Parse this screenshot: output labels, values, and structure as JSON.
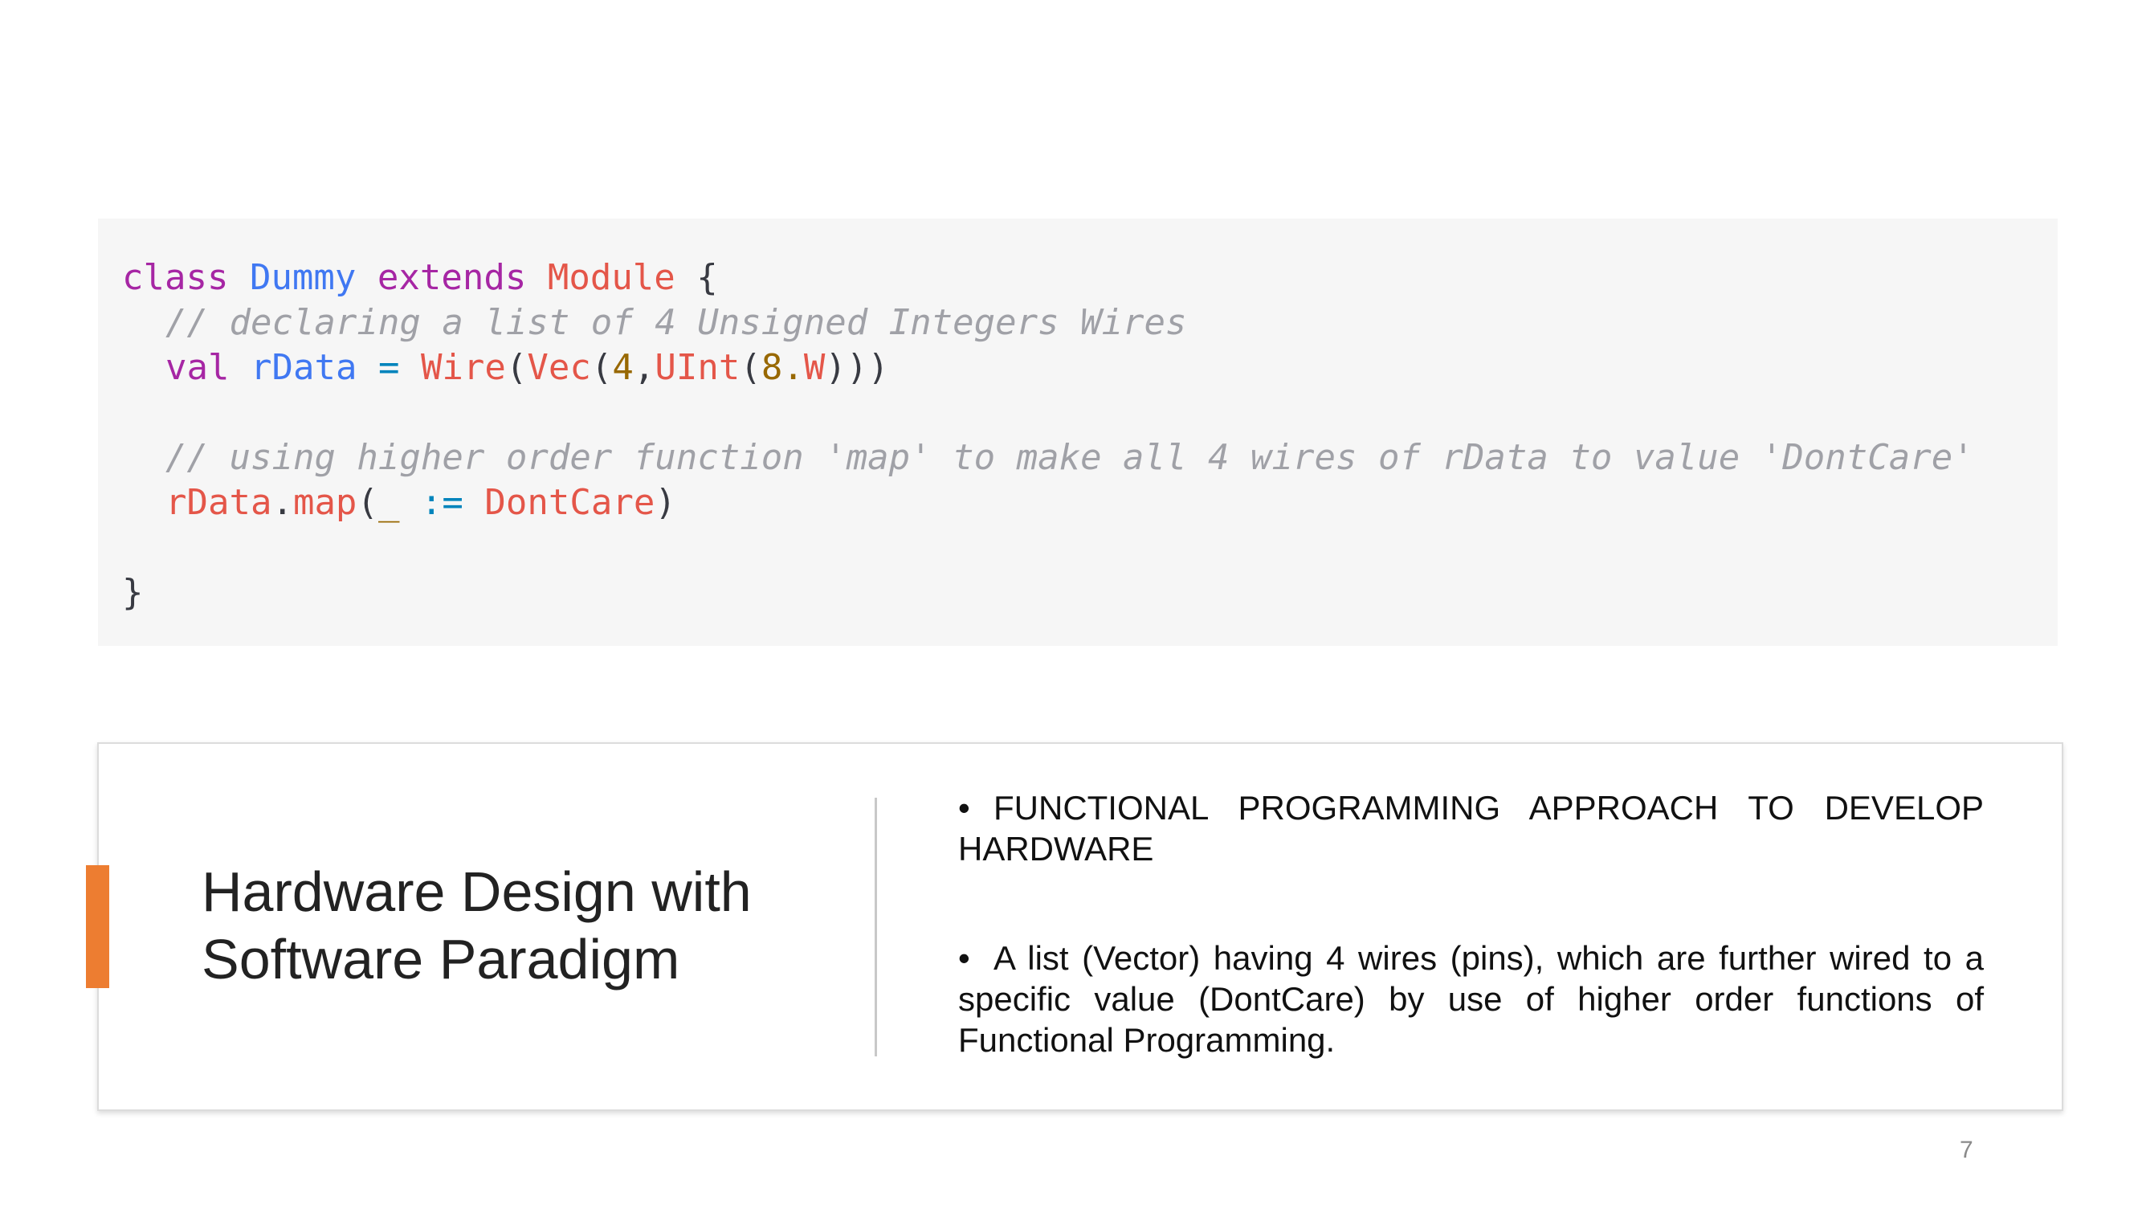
{
  "code": {
    "line1": {
      "kw": "class",
      "name": "Dummy",
      "extends": "extends",
      "parent": "Module",
      "brace": "{"
    },
    "line2": {
      "comment": "// declaring a list of 4 Unsigned Integers Wires"
    },
    "line3": {
      "kw": "val",
      "name": "rData",
      "eq": "=",
      "wire": "Wire",
      "p1": "(",
      "vec": "Vec",
      "p2": "(",
      "n4": "4",
      "comma": ",",
      "uint": "UInt",
      "p3": "(",
      "n8": "8",
      "dot": ".",
      "w": "W",
      "close": ")))"
    },
    "line4": {
      "comment": "// using higher order function 'map' to make all 4 wires of rData to value 'DontCare'"
    },
    "line5": {
      "obj": "rData",
      "dot": ".",
      "map": "map",
      "open": "(",
      "underscore": "_",
      "assign": ":=",
      "dontcare": "DontCare",
      "close": ")"
    },
    "line6": {
      "brace": "}"
    }
  },
  "card": {
    "title_line1": "Hardware Design with",
    "title_line2": "Software Paradigm",
    "bullets": [
      {
        "marker": "•",
        "text": "FUNCTIONAL PROGRAMMING APPROACH TO DEVELOP HARDWARE"
      },
      {
        "marker": "•",
        "text": "A list (Vector) having 4 wires (pins), which are further wired to a specific value (DontCare) by use of higher order functions of Functional Programming."
      }
    ]
  },
  "page_number": "7",
  "colors": {
    "accent": "#ed7d31",
    "code_background": "#f6f6f6",
    "keyword": "#a626a4",
    "type": "#4078f2",
    "function": "#e45649",
    "number": "#986801",
    "operator": "#0184bc",
    "comment": "#a0a1a7"
  }
}
